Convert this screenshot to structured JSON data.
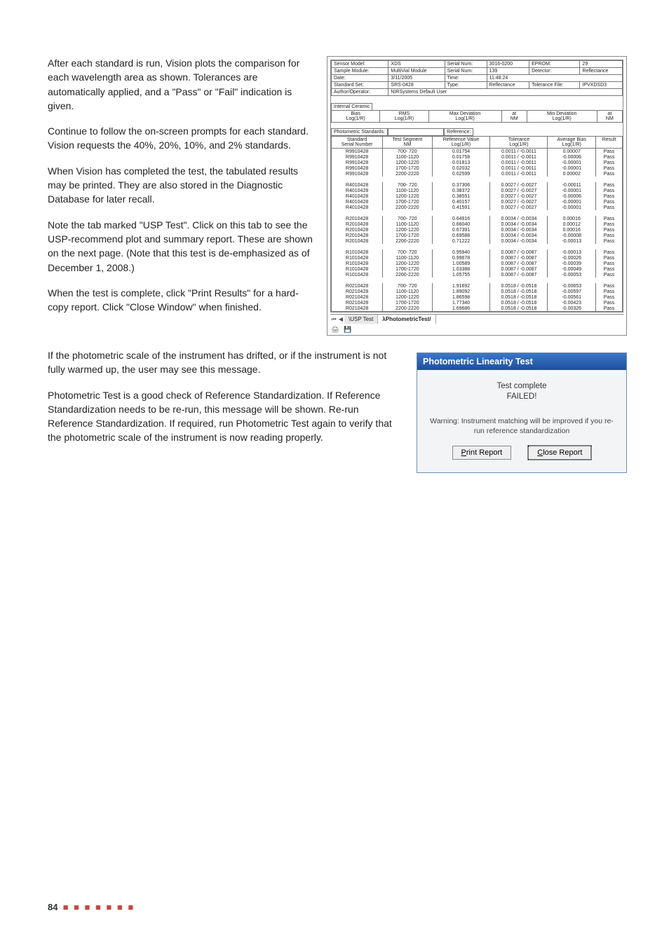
{
  "paragraphs": {
    "p1": "After each standard is run, Vision plots the comparison for each wavelength area as shown. Tolerances are automatically applied, and a \"Pass\" or \"Fail\" indication is given.",
    "p2": "Continue to follow the on-screen prompts for each standard. Vision requests the 40%, 20%, 10%, and 2% standards.",
    "p3": "When Vision has completed the test, the tabulated results may be printed. They are also stored in the Diagnostic Database for later recall.",
    "p4": "Note the tab marked \"USP Test\". Click on this tab to see the USP-recommend plot and summary report. These are shown on the next page. (Note that this test is de-emphasized as of December 1, 2008.)",
    "p5": "When the test is complete, click \"Print Results\" for a hard-copy report. Click \"Close Window\" when finished.",
    "p6": "If the photometric scale of the instrument has drifted, or if the instrument is not fully warmed up, the user may see this message.",
    "p7": "Photometric Test is a good check of Reference Standardization. If Reference Standardization needs to be re-run, this message will be shown. Re-run Reference Standardization. If required, run Photometric Test again to verify that the photometric scale of the instrument is now reading properly."
  },
  "spreadsheet": {
    "meta": {
      "sensor_model_label": "Sensor Model:",
      "sensor_model": "XDS",
      "serial_num_label": "Serial Num:",
      "serial_num": "3016-0200",
      "eprom_label": "EPROM:",
      "eprom": "29",
      "sample_module_label": "Sample Module:",
      "sample_module": "MultiVial Module",
      "serial_num2_label": "Serial Num:",
      "serial_num2": "139",
      "detector_label": "Detector:",
      "detector": "Reflectance",
      "date_label": "Date:",
      "date": "3/11/2005",
      "time_label": "Time:",
      "time": "11:48:24",
      "standard_set_label": "Standard Set:",
      "standard_set": "SRS-0428",
      "type_label": "Type:",
      "type": "Reflectance",
      "tolerance_file_label": "Tolerance File:",
      "tolerance_file": "IPVXDSD3",
      "author_label": "Author/Operator:",
      "author": "NIRSystems Default User"
    },
    "internal": {
      "title": "Internal Ceramic",
      "headers": {
        "bias": "Bias",
        "biasu": "Log(1/R)",
        "rms": "RMS",
        "rmsu": "Log(1/R)",
        "maxdev": "Max Deviation",
        "maxdevu": "Log(1/R)",
        "at1": "at",
        "at1u": "NM",
        "mindev": "Min Deviation",
        "mindevu": "Log(1/R)",
        "at2": "at",
        "at2u": "NM"
      }
    },
    "photo": {
      "title": "Photometric Standards:",
      "ref_label": "Reference:",
      "headers": {
        "std": "Standard",
        "seg": "Test Segment",
        "refv": "Reference Value",
        "tol": "Tolerance",
        "avg": "Average Bias",
        "res": "Result",
        "sn": "Serial Number",
        "nm": "NM",
        "log1": "Log(1/R)",
        "log2": "Log(1/R)",
        "log3": "Log(1/R)"
      }
    },
    "rows": [
      {
        "sn": "R9910428",
        "seg": "700- 720",
        "ref": "0.01754",
        "tol": "0.0011 / -0.0011",
        "avg": "0.00007",
        "res": "Pass"
      },
      {
        "sn": "R9910428",
        "seg": "1100-1120",
        "ref": "0.01758",
        "tol": "0.0011 / -0.0011",
        "avg": "-0.00006",
        "res": "Pass"
      },
      {
        "sn": "R9910428",
        "seg": "1200-1220",
        "ref": "0.01813",
        "tol": "0.0011 / -0.0011",
        "avg": "-0.00001",
        "res": "Pass"
      },
      {
        "sn": "R9910428",
        "seg": "1700-1720",
        "ref": "0.02032",
        "tol": "0.0011 / -0.0011",
        "avg": "-0.00001",
        "res": "Pass"
      },
      {
        "sn": "R9910428",
        "seg": "2200-2220",
        "ref": "0.02599",
        "tol": "0.0011 / -0.0011",
        "avg": "0.00002",
        "res": "Pass"
      },
      {
        "gap": true
      },
      {
        "sn": "R4010428",
        "seg": "700- 720",
        "ref": "0.37306",
        "tol": "0.0027 / -0.0027",
        "avg": "-0.00011",
        "res": "Pass"
      },
      {
        "sn": "R4010428",
        "seg": "1100-1120",
        "ref": "0.38372",
        "tol": "0.0027 / -0.0027",
        "avg": "-0.00001",
        "res": "Pass"
      },
      {
        "sn": "R4010428",
        "seg": "1200-1220",
        "ref": "0.38551",
        "tol": "0.0027 / -0.0027",
        "avg": "-0.00006",
        "res": "Pass"
      },
      {
        "sn": "R4010428",
        "seg": "1700-1720",
        "ref": "0.40157",
        "tol": "0.0027 / -0.0027",
        "avg": "-0.00001",
        "res": "Pass"
      },
      {
        "sn": "R4010428",
        "seg": "2200-2220",
        "ref": "0.41591",
        "tol": "0.0027 / -0.0027",
        "avg": "-0.00001",
        "res": "Pass"
      },
      {
        "gap": true
      },
      {
        "sn": "R2010428",
        "seg": "700- 720",
        "ref": "0.64916",
        "tol": "0.0034 / -0.0034",
        "avg": "0.00016",
        "res": "Pass"
      },
      {
        "sn": "R2010428",
        "seg": "1100-1120",
        "ref": "0.66040",
        "tol": "0.0034 / -0.0034",
        "avg": "0.00012",
        "res": "Pass"
      },
      {
        "sn": "R2010428",
        "seg": "1200-1220",
        "ref": "0.67391",
        "tol": "0.0034 / -0.0034",
        "avg": "0.00016",
        "res": "Pass"
      },
      {
        "sn": "R2010428",
        "seg": "1700-1720",
        "ref": "0.69588",
        "tol": "0.0034 / -0.0034",
        "avg": "-0.00008",
        "res": "Pass"
      },
      {
        "sn": "R2010428",
        "seg": "2200-2220",
        "ref": "0.71222",
        "tol": "0.0034 / -0.0034",
        "avg": "-0.00013",
        "res": "Pass"
      },
      {
        "gap": true
      },
      {
        "sn": "R1010428",
        "seg": "700- 720",
        "ref": "0.95940",
        "tol": "0.0087 / -0.0087",
        "avg": "-0.00013",
        "res": "Pass"
      },
      {
        "sn": "R1010428",
        "seg": "1100-1120",
        "ref": "0.99678",
        "tol": "0.0087 / -0.0087",
        "avg": "-0.00026",
        "res": "Pass"
      },
      {
        "sn": "R1010428",
        "seg": "1200-1220",
        "ref": "1.00589",
        "tol": "0.0087 / -0.0087",
        "avg": "-0.00039",
        "res": "Pass"
      },
      {
        "sn": "R1010428",
        "seg": "1700-1720",
        "ref": "1.03388",
        "tol": "0.0087 / -0.0087",
        "avg": "-0.00049",
        "res": "Pass"
      },
      {
        "sn": "R1010428",
        "seg": "2200-2220",
        "ref": "1.05755",
        "tol": "0.0087 / -0.0087",
        "avg": "-0.00053",
        "res": "Pass"
      },
      {
        "gap": true
      },
      {
        "sn": "R0210428",
        "seg": "700- 720",
        "ref": "1.91692",
        "tol": "0.0518 / -0.0518",
        "avg": "-0.00653",
        "res": "Pass"
      },
      {
        "sn": "R0210428",
        "seg": "1100-1120",
        "ref": "1.89092",
        "tol": "0.0518 / -0.0518",
        "avg": "-0.00597",
        "res": "Pass"
      },
      {
        "sn": "R0210428",
        "seg": "1200-1220",
        "ref": "1.86598",
        "tol": "0.0518 / -0.0518",
        "avg": "-0.00561",
        "res": "Pass"
      },
      {
        "sn": "R0210428",
        "seg": "1700-1720",
        "ref": "1.77340",
        "tol": "0.0518 / -0.0518",
        "avg": "-0.00423",
        "res": "Pass"
      },
      {
        "sn": "R0210428",
        "seg": "2200-2220",
        "ref": "1.69686",
        "tol": "0.0518 / -0.0518",
        "avg": "-0.00326",
        "res": "Pass"
      }
    ],
    "tabs": {
      "usp": "USP Test",
      "photo": "PhotometricTest"
    }
  },
  "dialog": {
    "title": "Photometric Linearity Test",
    "line1": "Test complete",
    "line2": "FAILED!",
    "warning": "Warning: Instrument matching will be improved if you re-run reference standardization",
    "print_u": "P",
    "print_rest": "rint Report",
    "close_u": "C",
    "close_rest": "lose Report"
  },
  "footer": {
    "page": "84",
    "dots": "■ ■ ■ ■ ■ ■ ■"
  }
}
